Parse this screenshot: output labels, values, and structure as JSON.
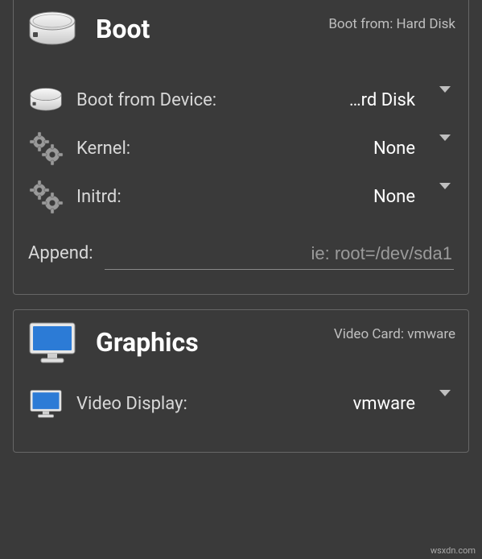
{
  "boot": {
    "title": "Boot",
    "subtitle_prefix": "Boot from: ",
    "subtitle_value": "Hard Disk",
    "device_label": "Boot from Device:",
    "device_value": "…rd Disk",
    "kernel_label": "Kernel:",
    "kernel_value": "None",
    "initrd_label": "Initrd:",
    "initrd_value": "None",
    "append_label": "Append:",
    "append_placeholder": "ie: root=/dev/sda1",
    "append_value": ""
  },
  "graphics": {
    "title": "Graphics",
    "subtitle_prefix": "Video Card: ",
    "subtitle_value": "vmware",
    "videodisplay_label": "Video Display:",
    "videodisplay_value": "vmware"
  },
  "watermark": "wsxdn.com"
}
